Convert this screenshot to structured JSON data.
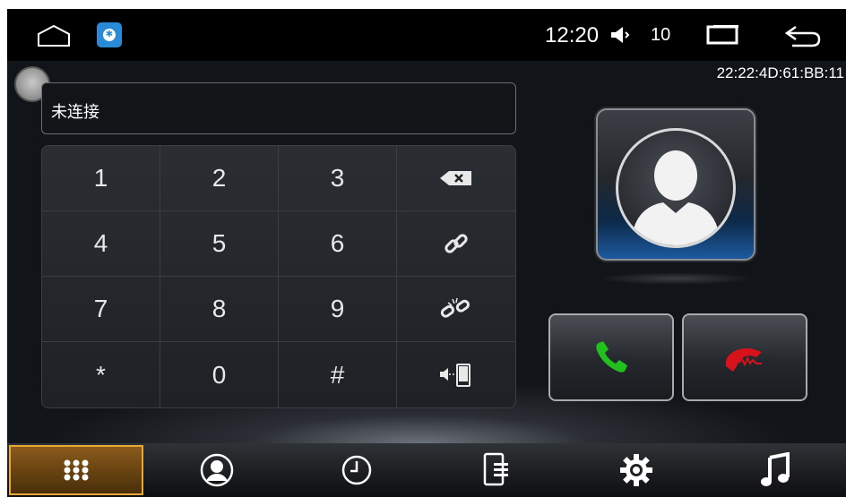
{
  "status_bar": {
    "time": "12:20",
    "volume_level": "10",
    "icons": [
      "home-icon",
      "bluetooth-icon",
      "volume-icon",
      "recent-apps-icon",
      "back-icon"
    ]
  },
  "device": {
    "mac_address": "22:22:4D:61:BB:11"
  },
  "connection": {
    "status": "未连接"
  },
  "keypad": {
    "keys": [
      "1",
      "2",
      "3",
      "⌫",
      "4",
      "5",
      "6",
      "link",
      "7",
      "8",
      "9",
      "unlink",
      "*",
      "0",
      "#",
      "transfer"
    ],
    "labels": {
      "k1": "1",
      "k2": "2",
      "k3": "3",
      "k4": "4",
      "k5": "5",
      "k6": "6",
      "k7": "7",
      "k8": "8",
      "k9": "9",
      "kstar": "*",
      "k0": "0",
      "khash": "#"
    }
  },
  "actions": {
    "answer_color": "#22c01e",
    "hangup_color": "#d8121a"
  },
  "bottom_nav": {
    "items": [
      "dialpad",
      "contacts",
      "call-history",
      "sms",
      "settings",
      "music"
    ],
    "active": "dialpad",
    "accent": "#e8a838"
  }
}
